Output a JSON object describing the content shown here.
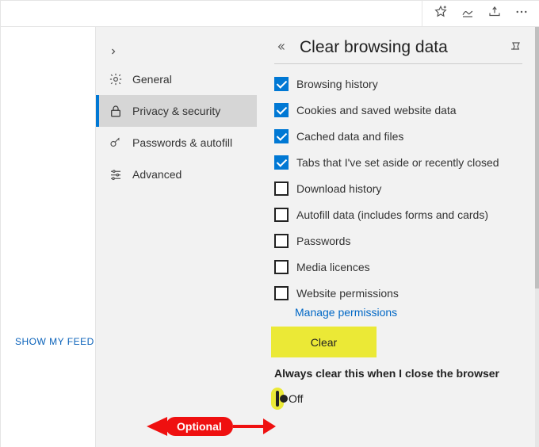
{
  "page": {
    "title": "Clear browsing data",
    "show_feed": "SHOW MY FEED"
  },
  "sidebar": {
    "items": [
      {
        "label": "General"
      },
      {
        "label": "Privacy & security"
      },
      {
        "label": "Passwords & autofill"
      },
      {
        "label": "Advanced"
      }
    ]
  },
  "checks": [
    {
      "label": "Browsing history",
      "checked": true
    },
    {
      "label": "Cookies and saved website data",
      "checked": true
    },
    {
      "label": "Cached data and files",
      "checked": true
    },
    {
      "label": "Tabs that I've set aside or recently closed",
      "checked": true
    },
    {
      "label": "Download history",
      "checked": false
    },
    {
      "label": "Autofill data (includes forms and cards)",
      "checked": false
    },
    {
      "label": "Passwords",
      "checked": false
    },
    {
      "label": "Media licences",
      "checked": false
    },
    {
      "label": "Website permissions",
      "checked": false
    }
  ],
  "manage_link": "Manage permissions",
  "clear_btn": "Clear",
  "toggle": {
    "heading": "Always clear this when I close the browser",
    "state": "Off"
  },
  "anno": {
    "optional": "Optional"
  }
}
